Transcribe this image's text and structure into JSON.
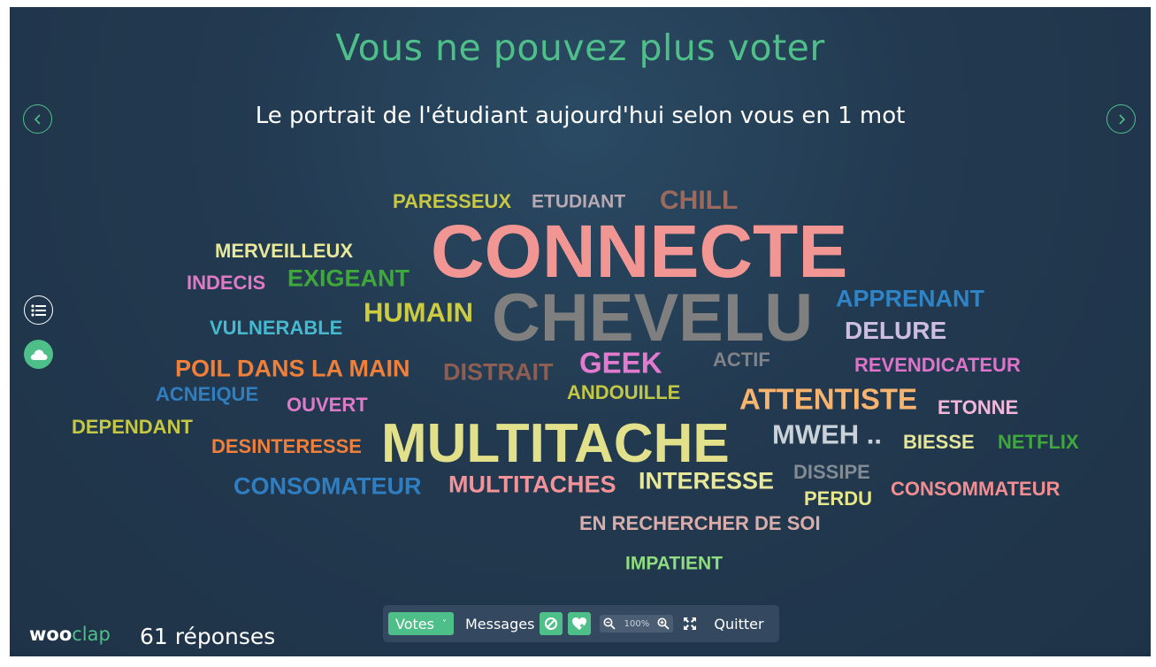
{
  "header": {
    "title": "Vous ne pouvez plus voter",
    "question": "Le portrait de l'étudiant aujourd'hui selon vous en 1 mot"
  },
  "navigation": {
    "prev_icon": "chevron-left-icon",
    "next_icon": "chevron-right-icon"
  },
  "side_controls": [
    {
      "icon": "list-icon"
    },
    {
      "icon": "cloud-icon"
    }
  ],
  "colors": {
    "accent": "#4fbf8a",
    "background": "#22394f",
    "toolbar": "#34495f"
  },
  "word_cloud": {
    "words": [
      {
        "text": "PARESSEUX",
        "color": "#c8c842"
      },
      {
        "text": "ETUDIANT",
        "color": "#b9a9b3"
      },
      {
        "text": "CHILL",
        "color": "#9c6a5c"
      },
      {
        "text": "CONNECTE",
        "color": "#f29694"
      },
      {
        "text": "MERVEILLEUX",
        "color": "#e8e89a"
      },
      {
        "text": "EXIGEANT",
        "color": "#3ea83a"
      },
      {
        "text": "INDECIS",
        "color": "#e07ac6"
      },
      {
        "text": "HUMAIN",
        "color": "#cccc3e"
      },
      {
        "text": "CHEVELU",
        "color": "#7f7f7f"
      },
      {
        "text": "APPRENANT",
        "color": "#2e84c6"
      },
      {
        "text": "VULNERABLE",
        "color": "#45b9cf"
      },
      {
        "text": "DELURE",
        "color": "#cdbde0"
      },
      {
        "text": "POIL DANS LA MAIN",
        "color": "#f07f3a"
      },
      {
        "text": "DISTRAIT",
        "color": "#8f5e52"
      },
      {
        "text": "GEEK",
        "color": "#e27ad0"
      },
      {
        "text": "ACTIF",
        "color": "#808287"
      },
      {
        "text": "REVENDICATEUR",
        "color": "#df72c9"
      },
      {
        "text": "ACNEIQUE",
        "color": "#2f7ec0"
      },
      {
        "text": "ANDOUILLE",
        "color": "#c2c844"
      },
      {
        "text": "OUVERT",
        "color": "#df7ac8"
      },
      {
        "text": "ATTENTISTE",
        "color": "#f8b46e"
      },
      {
        "text": "ETONNE",
        "color": "#f2b8dc"
      },
      {
        "text": "DEPENDANT",
        "color": "#c4c844"
      },
      {
        "text": "MULTITACHE",
        "color": "#e2e08a"
      },
      {
        "text": "MWEH ..",
        "color": "#c9d1d9"
      },
      {
        "text": "BIESSE",
        "color": "#e6e69a"
      },
      {
        "text": "NETFLIX",
        "color": "#3fa83d"
      },
      {
        "text": "DESINTERESSE",
        "color": "#ef7f3b"
      },
      {
        "text": "DISSIPE",
        "color": "#828b94"
      },
      {
        "text": "CONSOMATEUR",
        "color": "#2f7ec2"
      },
      {
        "text": "MULTITACHES",
        "color": "#f2939a"
      },
      {
        "text": "INTERESSE",
        "color": "#e8e89a"
      },
      {
        "text": "PERDU",
        "color": "#e6e68a"
      },
      {
        "text": "CONSOMMATEUR",
        "color": "#f08e92"
      },
      {
        "text": "EN RECHERCHER DE SOI",
        "color": "#d9aeaa"
      },
      {
        "text": "IMPATIENT",
        "color": "#8fdc82"
      }
    ]
  },
  "footer": {
    "logo_part1": "woo",
    "logo_part2": "clap",
    "responses": "61 réponses"
  },
  "toolbar": {
    "votes_label": "Votes",
    "messages_label": "Messages",
    "block_icon": "block-icon",
    "heart_icon": "heart-upload-icon",
    "zoom_level": "100%",
    "zoom_out_icon": "zoom-out-icon",
    "zoom_in_icon": "zoom-in-icon",
    "fullscreen_icon": "fullscreen-icon",
    "quit_label": "Quitter"
  }
}
